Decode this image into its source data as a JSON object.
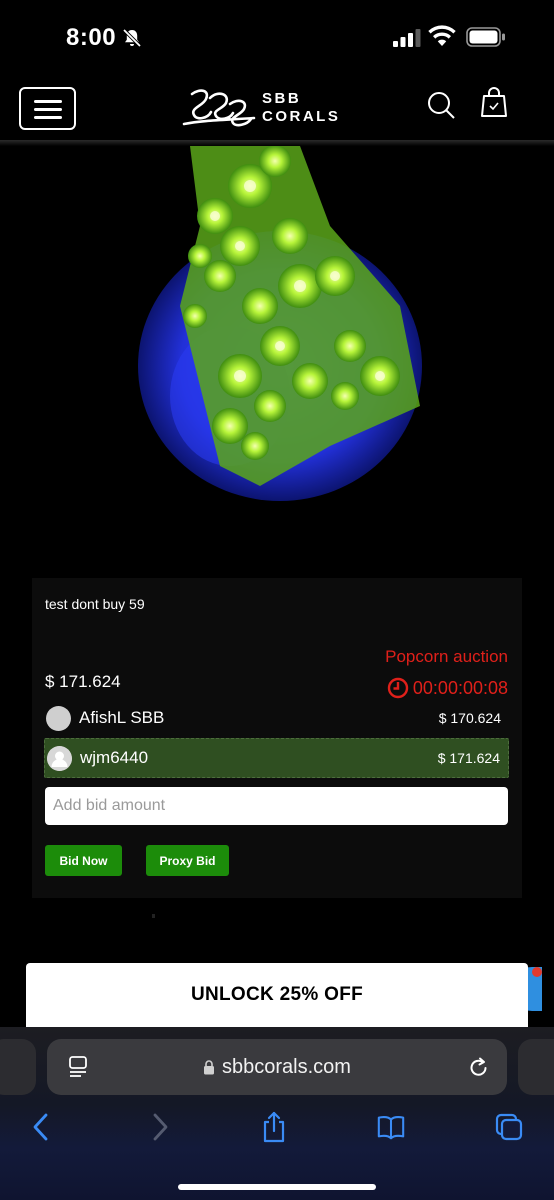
{
  "status_bar": {
    "time": "8:00"
  },
  "header": {
    "logo_line1": "SBB",
    "logo_line2": "CORALS"
  },
  "product": {
    "title": "test dont buy 59",
    "auction_type": "Popcorn auction",
    "current_price": "$ 171.624",
    "timer": "00:00:00:08",
    "bids": [
      {
        "user": "AfishL SBB",
        "amount": "$ 170.624"
      },
      {
        "user": "wjm6440",
        "amount": "$ 171.624"
      }
    ],
    "bid_placeholder": "Add bid amount",
    "bid_now_label": "Bid Now",
    "proxy_bid_label": "Proxy Bid"
  },
  "promo": {
    "label": "UNLOCK 25% OFF"
  },
  "browser": {
    "url": "sbbcorals.com"
  },
  "colors": {
    "accent_red": "#e0201a",
    "button_green": "#1c8c0a",
    "highlight_row": "#2f4f21"
  }
}
